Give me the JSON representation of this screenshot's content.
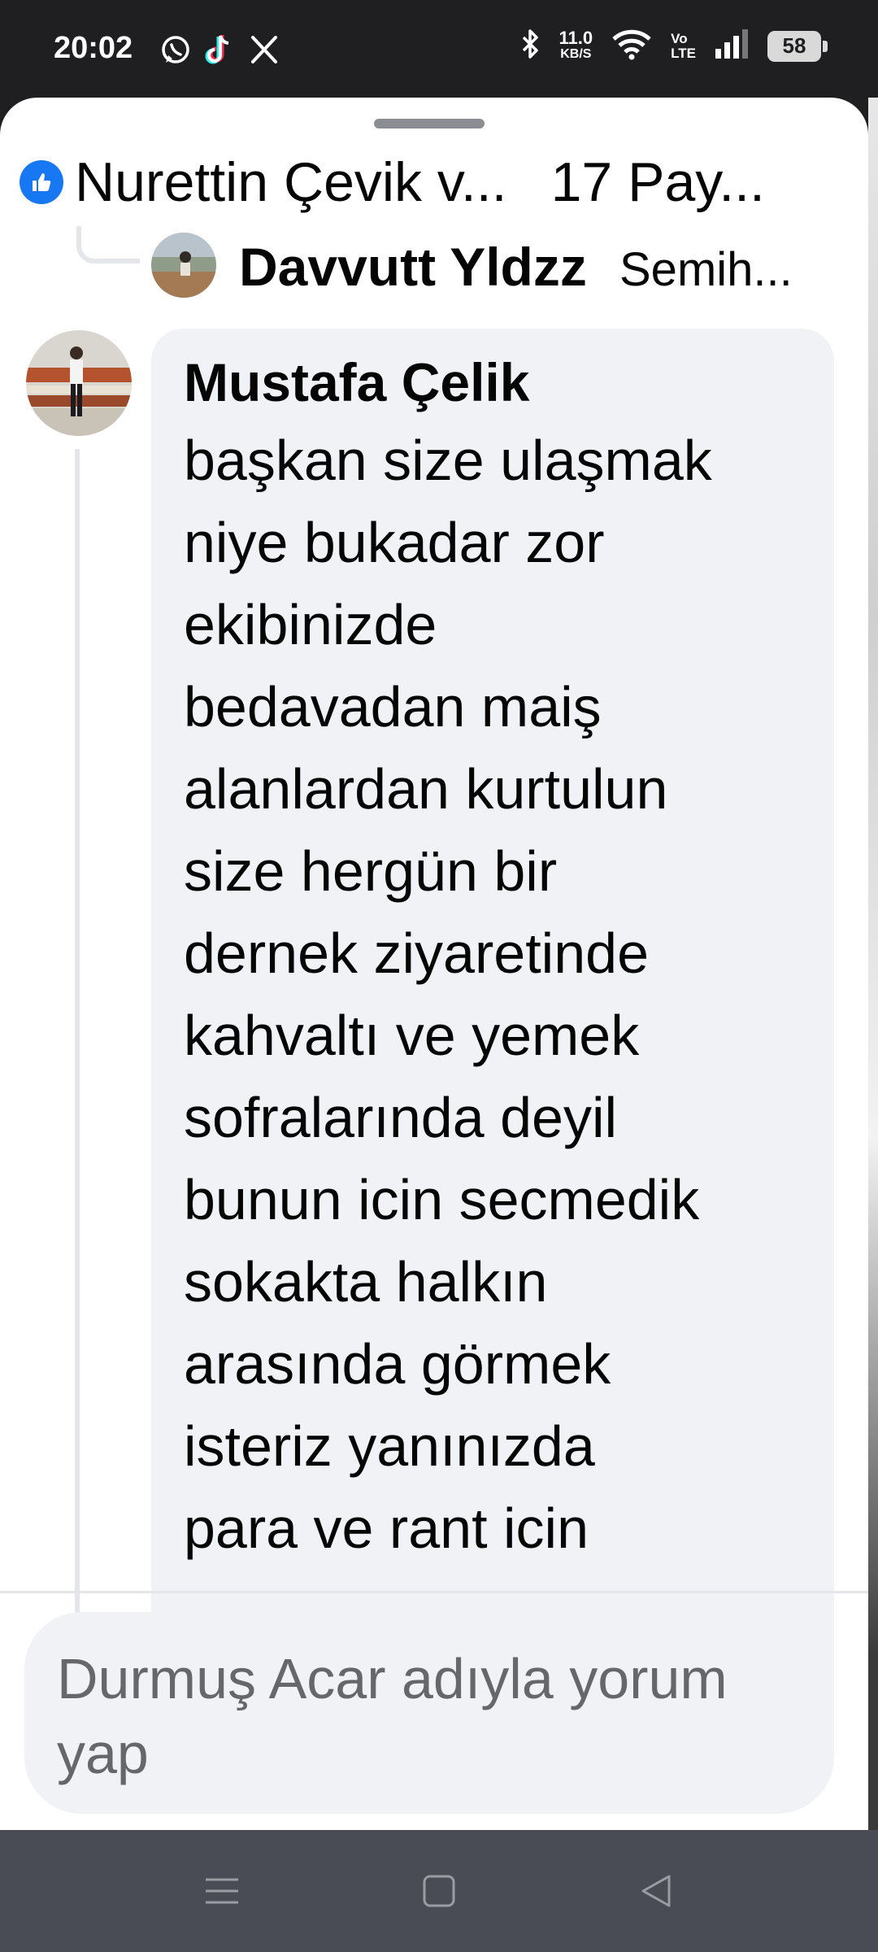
{
  "status_bar": {
    "time": "20:02",
    "app_icons": [
      "whatsapp-icon",
      "tiktok-icon",
      "x-icon"
    ],
    "net_speed": "11.0",
    "net_speed_unit": "KB/S",
    "volte_top": "Vo",
    "volte_bottom": "LTE",
    "battery": "58"
  },
  "header": {
    "reaction_icon": "like-icon",
    "names": "Nurettin Çevik v...",
    "shares": "17 Pay..."
  },
  "reply_preview": {
    "name": "Davvutt Yldzz",
    "snippet": "Semih..."
  },
  "comment": {
    "author": "Mustafa Çelik",
    "lines": [
      "başkan size ulaşmak",
      "niye bukadar zor",
      "ekibinizde",
      "bedavadan maiş",
      "alanlardan kurtulun",
      "size hergün bir",
      "dernek ziyaretinde",
      "kahvaltı ve yemek",
      "sofralarında deyil",
      "bunun icin secmedik",
      "sokakta halkın",
      "arasında görmek",
      "isteriz yanınızda",
      "para ve rant icin"
    ]
  },
  "composer": {
    "placeholder": "Durmuş Acar adıyla yorum yap"
  },
  "nav": [
    "menu-icon",
    "home-square-icon",
    "back-triangle-icon"
  ],
  "colors": {
    "facebook_blue": "#1877f2",
    "bubble": "#f0f2f5",
    "secondary_text": "#65676b"
  }
}
